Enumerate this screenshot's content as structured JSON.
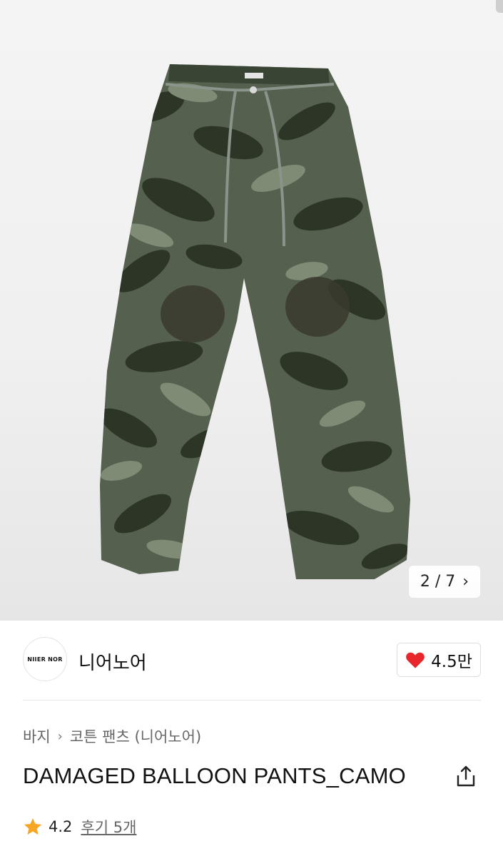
{
  "gallery": {
    "current": "2",
    "total": "7",
    "separator": "/",
    "next_icon": "chevron-right-icon"
  },
  "brand": {
    "logo_text": "NIIER NOR",
    "name": "니어노어",
    "like_count": "4.5만",
    "like_icon": "heart-icon",
    "like_color": "#e8262b"
  },
  "breadcrumb": {
    "items": [
      "바지",
      "코튼 팬츠 (니어노어)"
    ],
    "separator_icon": "chevron-right-icon"
  },
  "product": {
    "title": "DAMAGED BALLOON PANTS_CAMO",
    "share_icon": "share-icon"
  },
  "rating": {
    "star_icon": "star-icon",
    "star_color": "#f6a623",
    "value": "4.2",
    "review_label": "후기 5개"
  }
}
